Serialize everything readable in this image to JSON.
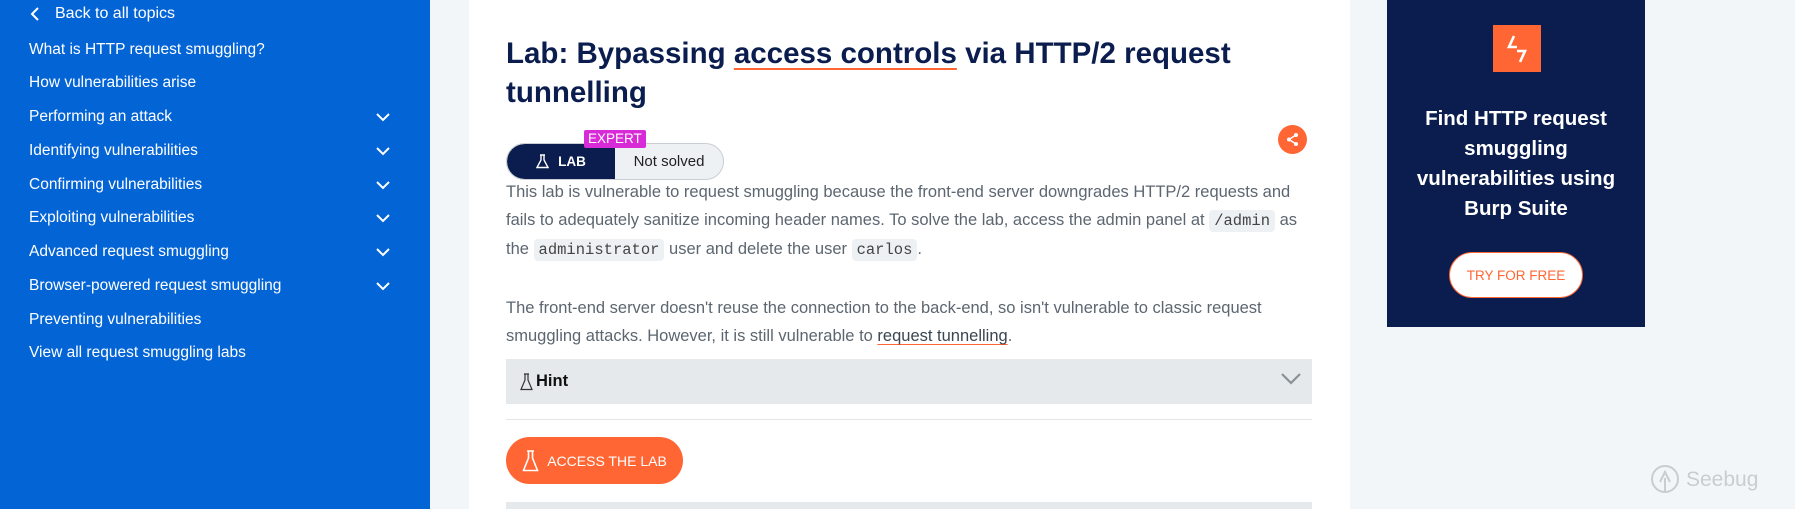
{
  "sidebar": {
    "back_label": "Back to all topics",
    "items": [
      {
        "label": "What is HTTP request smuggling?",
        "expandable": false
      },
      {
        "label": "How vulnerabilities arise",
        "expandable": false
      },
      {
        "label": "Performing an attack",
        "expandable": true
      },
      {
        "label": "Identifying vulnerabilities",
        "expandable": true
      },
      {
        "label": "Confirming vulnerabilities",
        "expandable": true
      },
      {
        "label": "Exploiting vulnerabilities",
        "expandable": true
      },
      {
        "label": "Advanced request smuggling",
        "expandable": true
      },
      {
        "label": "Browser-powered request smuggling",
        "expandable": true
      },
      {
        "label": "Preventing vulnerabilities",
        "expandable": false
      },
      {
        "label": "View all request smuggling labs",
        "expandable": false
      }
    ]
  },
  "lab": {
    "title_prefix": "Lab: Bypassing ",
    "title_link": "access controls",
    "title_suffix": " via HTTP/2 request tunnelling",
    "badge_lab": "LAB",
    "badge_level": "EXPERT",
    "badge_status": "Not solved",
    "p1_a": "This lab is vulnerable to request smuggling because the front-end server downgrades HTTP/2 requests and fails to adequately sanitize incoming header names. To solve the lab, access the admin panel at ",
    "p1_code1": "/admin",
    "p1_b": " as the ",
    "p1_code2": "administrator",
    "p1_c": " user and delete the user ",
    "p1_code3": "carlos",
    "p1_d": ".",
    "p2_a": "The front-end server doesn't reuse the connection to the back-end, so isn't vulnerable to classic request smuggling attacks. However, it is still vulnerable to ",
    "p2_link": "request tunnelling",
    "p2_b": ".",
    "hint_label": "Hint",
    "access_label": "ACCESS THE LAB"
  },
  "ad": {
    "text": "Find HTTP request smuggling vulnerabilities using Burp Suite",
    "button_label": "TRY FOR FREE"
  },
  "watermark": "Seebug",
  "colors": {
    "sidebar_bg": "#0364d6",
    "navy": "#0a1d4e",
    "accent_orange": "#ff6633",
    "expert_magenta": "#d82ad7"
  }
}
